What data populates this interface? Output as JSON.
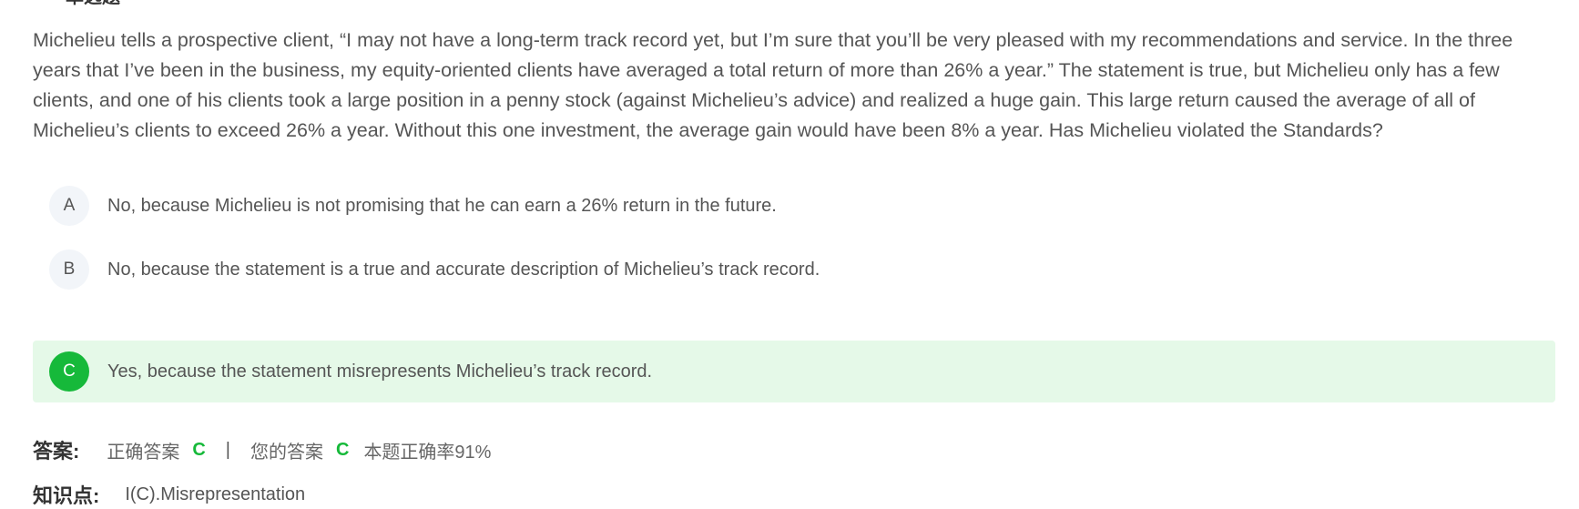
{
  "header": {
    "title": "单选题"
  },
  "question": {
    "text": "Michelieu tells a prospective client, “I may not have a long-term track record yet, but I’m sure that you’ll be very pleased with my recommendations and service. In the three years that I’ve been in the business, my equity-oriented clients have averaged a total return of more than 26% a year.” The statement is true, but Michelieu only has a few clients, and one of his clients took a large position in a penny stock (against Michelieu’s advice) and realized a huge gain. This large return caused the average of all of Michelieu’s clients to exceed 26% a year. Without this one investment, the average gain would have been 8% a year. Has Michelieu violated the Standards?"
  },
  "options": [
    {
      "letter": "A",
      "text": "No, because Michelieu is not promising that he can earn a 26% return in the future."
    },
    {
      "letter": "B",
      "text": "No, because the statement is a true and accurate description of Michelieu’s track record."
    },
    {
      "letter": "C",
      "text": "Yes, because the statement misrepresents Michelieu’s track record."
    }
  ],
  "selected_option": "C",
  "answer": {
    "label": "答案:",
    "correct_label": "正确答案",
    "correct_value": "C",
    "separator": "|",
    "yours_label": "您的答案",
    "yours_value": "C",
    "accuracy_text": "本题正确率91%"
  },
  "knowledge": {
    "label": "知识点:",
    "value": "I(C).Misrepresentation"
  },
  "colors": {
    "correct_green": "#16b93a",
    "selected_bg": "#e5f9e8",
    "option_circle_bg": "#f2f5f9"
  }
}
